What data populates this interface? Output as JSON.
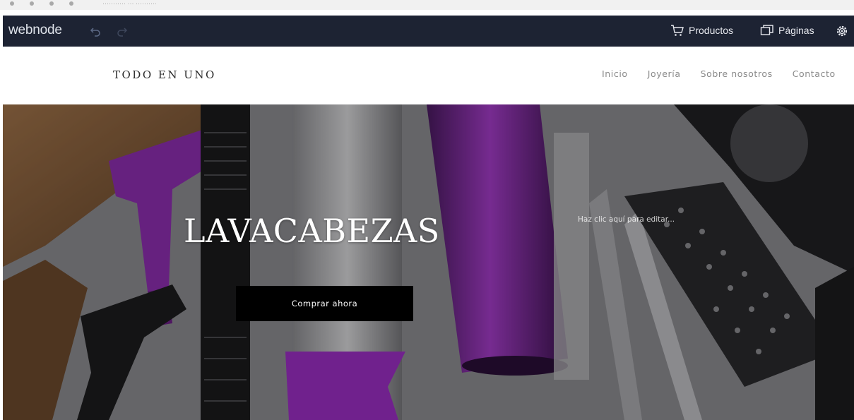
{
  "browser": {
    "address_text": "···········  ···  ··········"
  },
  "editor": {
    "logo": "webnode",
    "undo_icon": "undo-icon",
    "redo_icon": "redo-icon",
    "products_label": "Productos",
    "pages_label": "Páginas",
    "settings_icon": "gear-icon"
  },
  "site": {
    "brand": "TODO EN UNO",
    "nav": [
      "Inicio",
      "Joyería",
      "Sobre nosotros",
      "Contacto"
    ]
  },
  "hero": {
    "title": "LAVACABEZAS",
    "edit_hint": "Haz clic aquí para editar...",
    "cta_label": "Comprar ahora"
  },
  "colors": {
    "editor_bar": "#1d2333",
    "cta_bg": "#000000",
    "accent_purple": "#8e2fb0"
  }
}
